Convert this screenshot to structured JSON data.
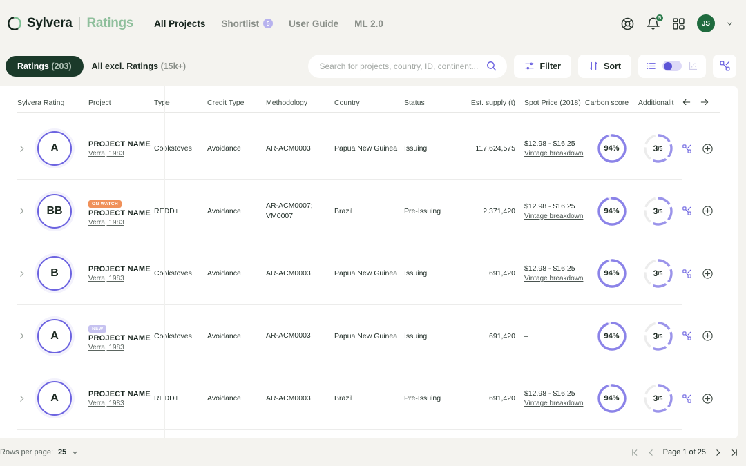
{
  "header": {
    "brand": "Sylvera",
    "brand_sub": "Ratings",
    "nav": [
      {
        "label": "All Projects",
        "active": true,
        "badge": ""
      },
      {
        "label": "Shortlist",
        "active": false,
        "badge": "5"
      },
      {
        "label": "User Guide",
        "active": false,
        "badge": ""
      },
      {
        "label": "ML 2.0",
        "active": false,
        "badge": ""
      }
    ],
    "help_icon": "lifebuoy-icon",
    "notifications_icon": "bell-icon",
    "notifications_count": "5",
    "apps_icon": "grid-apps-icon",
    "avatar_initials": "JS",
    "avatar_chevron": "chevron-down-icon"
  },
  "toolbar": {
    "tab_ratings": "Ratings",
    "tab_ratings_count": "(203)",
    "tab_all": "All excl. Ratings",
    "tab_all_count": "(15k+)",
    "search_placeholder": "Search for projects, country, ID, continent...",
    "search_value": "",
    "search_icon": "search-icon",
    "filter_label": "Filter",
    "filter_icon": "filter-sliders-icon",
    "sort_label": "Sort",
    "sort_icon": "sort-arrows-icon",
    "view_list_icon": "list-view-icon",
    "view_toggle": "on",
    "view_chart_icon": "scatter-chart-icon",
    "compare_icon": "compare-nodes-icon"
  },
  "table": {
    "columns": [
      "Sylvera Rating",
      "Project",
      "Type",
      "Credit Type",
      "Methodology",
      "Country",
      "Status",
      "Est. supply (t)",
      "Spot Price (2018)",
      "Carbon score",
      "Additionalit"
    ],
    "scroll_left_icon": "arrow-left-icon",
    "scroll_right_icon": "arrow-right-icon",
    "expand_icon": "chevron-right-icon",
    "compare_row_icon": "compare-nodes-icon",
    "add_row_icon": "plus-circle-icon",
    "rows": [
      {
        "rating": "A",
        "tag": "",
        "project": "PROJECT NAME",
        "registry": "Verra, 1983",
        "type": "Cookstoves",
        "credit_type": "Avoidance",
        "methodology": "AR-ACM0003",
        "country": "Papua New Guinea",
        "status": "Issuing",
        "supply": "117,624,575",
        "price": "$12.98 - $16.25",
        "price_link": "Vintage breakdown",
        "carbon_score": "94%",
        "carbon_pct": 94,
        "additionality": "3",
        "additionality_total": "/5",
        "additionality_filled": 3
      },
      {
        "rating": "BB",
        "tag": "ON WATCH",
        "project": "PROJECT NAME",
        "registry": "Verra, 1983",
        "type": "REDD+",
        "credit_type": "Avoidance",
        "methodology": "AR-ACM0007; VM0007",
        "country": "Brazil",
        "status": "Pre-Issuing",
        "supply": "2,371,420",
        "price": "$12.98 - $16.25",
        "price_link": "Vintage breakdown",
        "carbon_score": "94%",
        "carbon_pct": 94,
        "additionality": "3",
        "additionality_total": "/5",
        "additionality_filled": 3
      },
      {
        "rating": "B",
        "tag": "",
        "project": "PROJECT NAME",
        "registry": "Verra, 1983",
        "type": "Cookstoves",
        "credit_type": "Avoidance",
        "methodology": "AR-ACM0003",
        "country": "Papua New Guinea",
        "status": "Issuing",
        "supply": "691,420",
        "price": "$12.98 - $16.25",
        "price_link": "Vintage breakdown",
        "carbon_score": "94%",
        "carbon_pct": 94,
        "additionality": "3",
        "additionality_total": "/5",
        "additionality_filled": 3
      },
      {
        "rating": "A",
        "tag": "NEW",
        "project": "PROJECT NAME",
        "registry": "Verra, 1983",
        "type": "Cookstoves",
        "credit_type": "Avoidance",
        "methodology": "AR-ACM0003",
        "country": "Papua New Guinea",
        "status": "Issuing",
        "supply": "691,420",
        "price": "–",
        "price_link": "",
        "carbon_score": "94%",
        "carbon_pct": 94,
        "additionality": "3",
        "additionality_total": "/5",
        "additionality_filled": 3
      },
      {
        "rating": "A",
        "tag": "",
        "project": "PROJECT NAME",
        "registry": "Verra, 1983",
        "type": "REDD+",
        "credit_type": "Avoidance",
        "methodology": "AR-ACM0003",
        "country": "Brazil",
        "status": "Pre-Issuing",
        "supply": "691,420",
        "price": "$12.98 - $16.25",
        "price_link": "Vintage breakdown",
        "carbon_score": "94%",
        "carbon_pct": 94,
        "additionality": "3",
        "additionality_total": "/5",
        "additionality_filled": 3
      }
    ]
  },
  "footer": {
    "rows_per_page_label": "Rows per page:",
    "rows_per_page_value": "25",
    "rows_per_page_chevron": "chevron-down-icon",
    "first_icon": "first-page-icon",
    "prev_icon": "prev-page-icon",
    "page_text": "Page 1 of 25",
    "next_icon": "next-page-icon",
    "last_icon": "last-page-icon"
  },
  "colors": {
    "accent_purple": "#6c63e0",
    "brand_green": "#1b3a2a",
    "page_bg": "#f4f3ef",
    "tag_onwatch": "#f0915a",
    "tag_new": "#c6c2f0"
  }
}
